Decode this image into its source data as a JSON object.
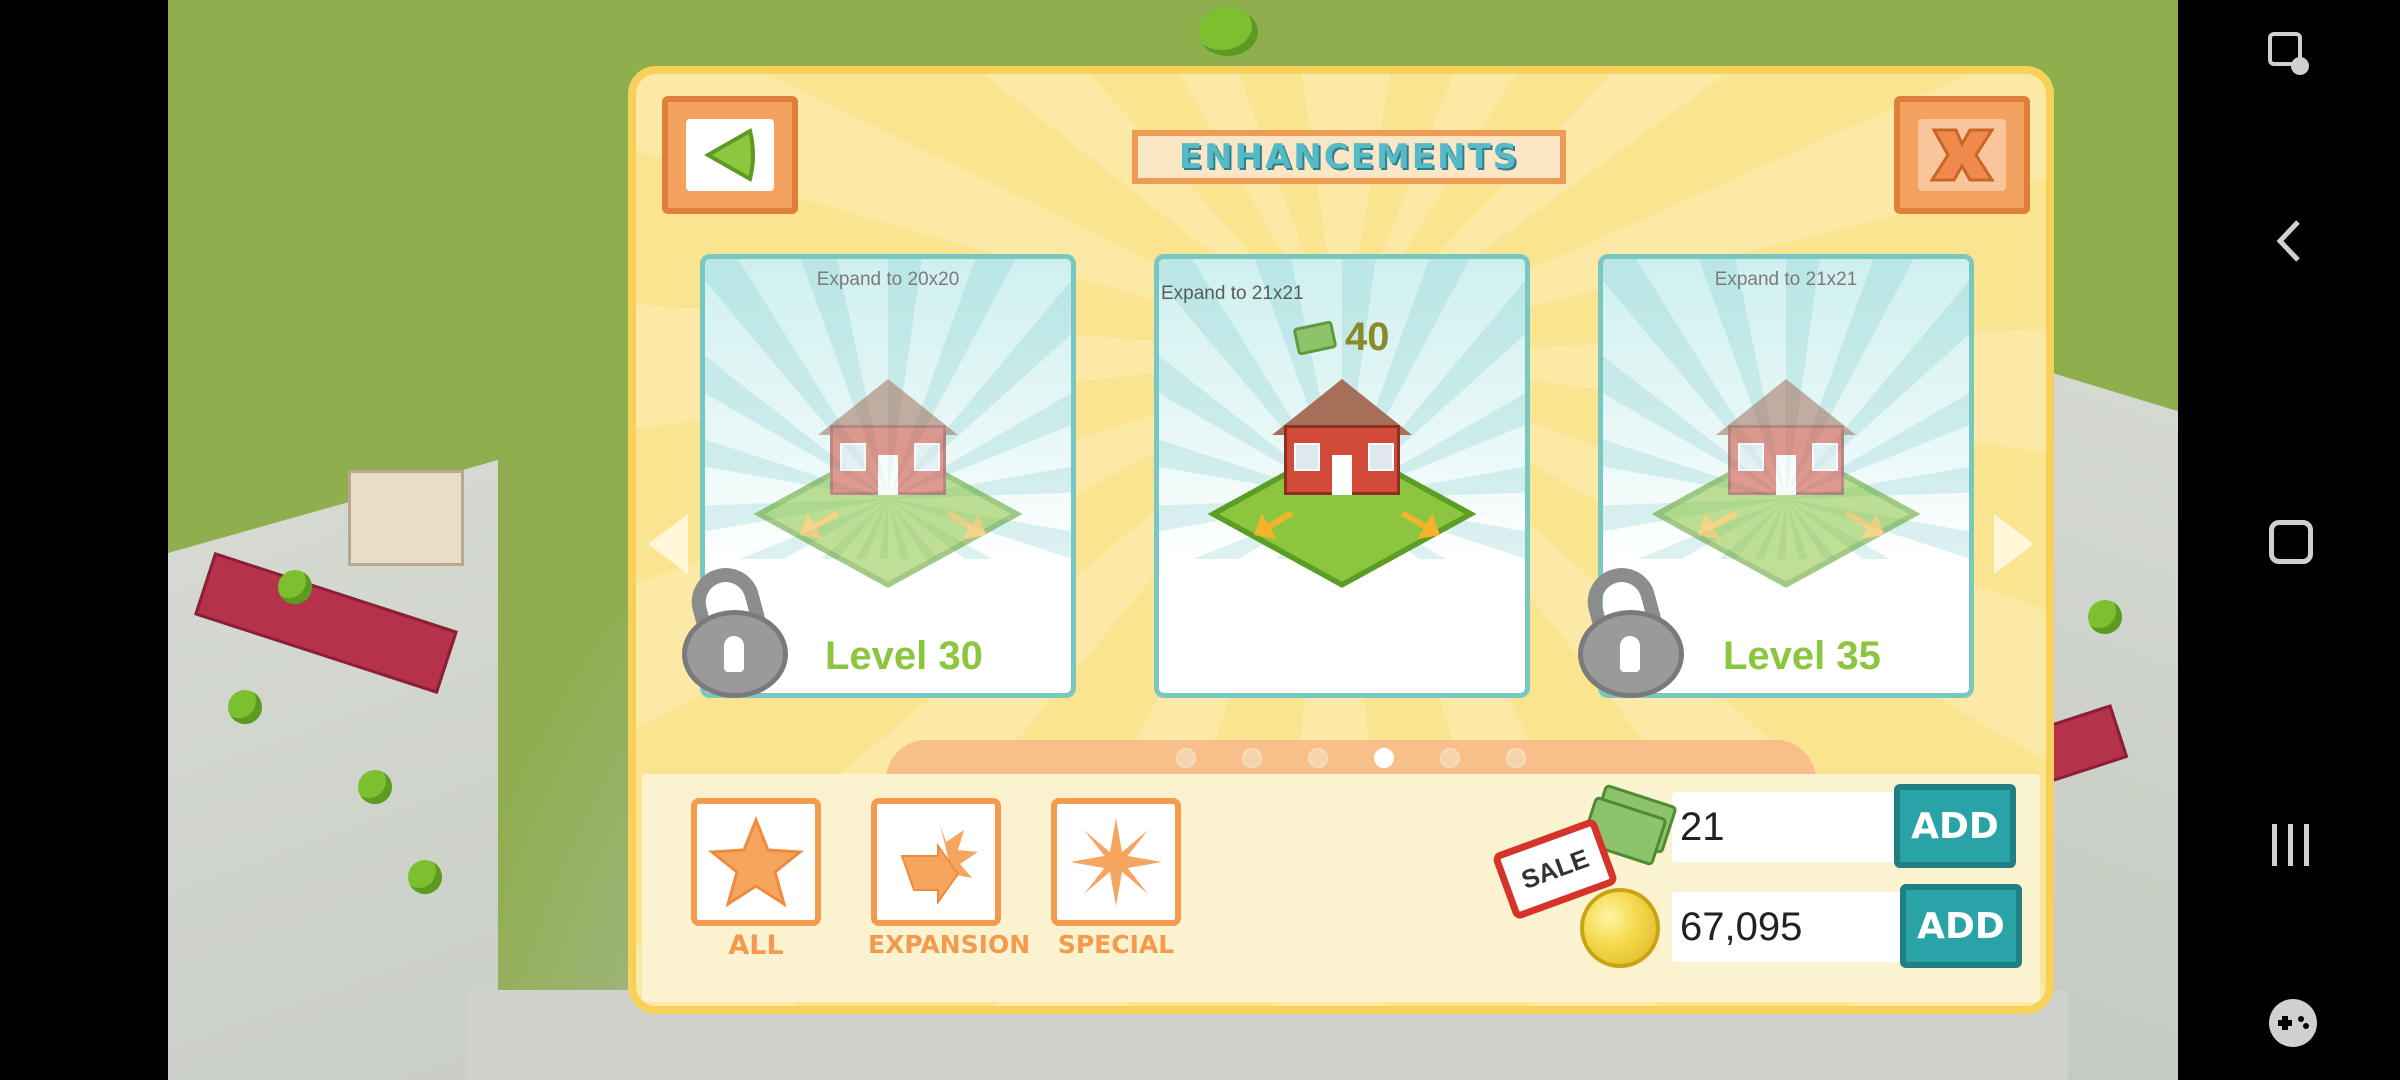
{
  "header": {
    "title": "ENHANCEMENTS"
  },
  "cards": [
    {
      "caption": "Expand to 20x20",
      "level": "Level 30",
      "locked": true
    },
    {
      "caption": "Expand to 21x21",
      "price": "40",
      "locked": false
    },
    {
      "caption": "Expand to 21x21",
      "level": "Level 35",
      "locked": true
    }
  ],
  "pager": {
    "count": 6,
    "active_index": 3
  },
  "categories": [
    {
      "label": "ALL",
      "icon": "star-icon"
    },
    {
      "label": "EXPANSION",
      "icon": "expansion-icon"
    },
    {
      "label": "SPECIAL",
      "icon": "burst-icon"
    }
  ],
  "currency": {
    "cash": "21",
    "coins": "67,095",
    "add_label": "ADD",
    "sale_label": "SALE"
  },
  "icons": {
    "back": "back-arrow-icon",
    "close": "close-x-icon",
    "lock": "padlock-icon",
    "system": [
      "screen-translate-icon",
      "back-icon",
      "home-icon",
      "recents-icon",
      "game-tools-icon"
    ]
  },
  "colors": {
    "panel": "#fbe48f",
    "accent_orange": "#f49a4d",
    "teal": "#2aa3a7",
    "level_green": "#8cc63f"
  }
}
